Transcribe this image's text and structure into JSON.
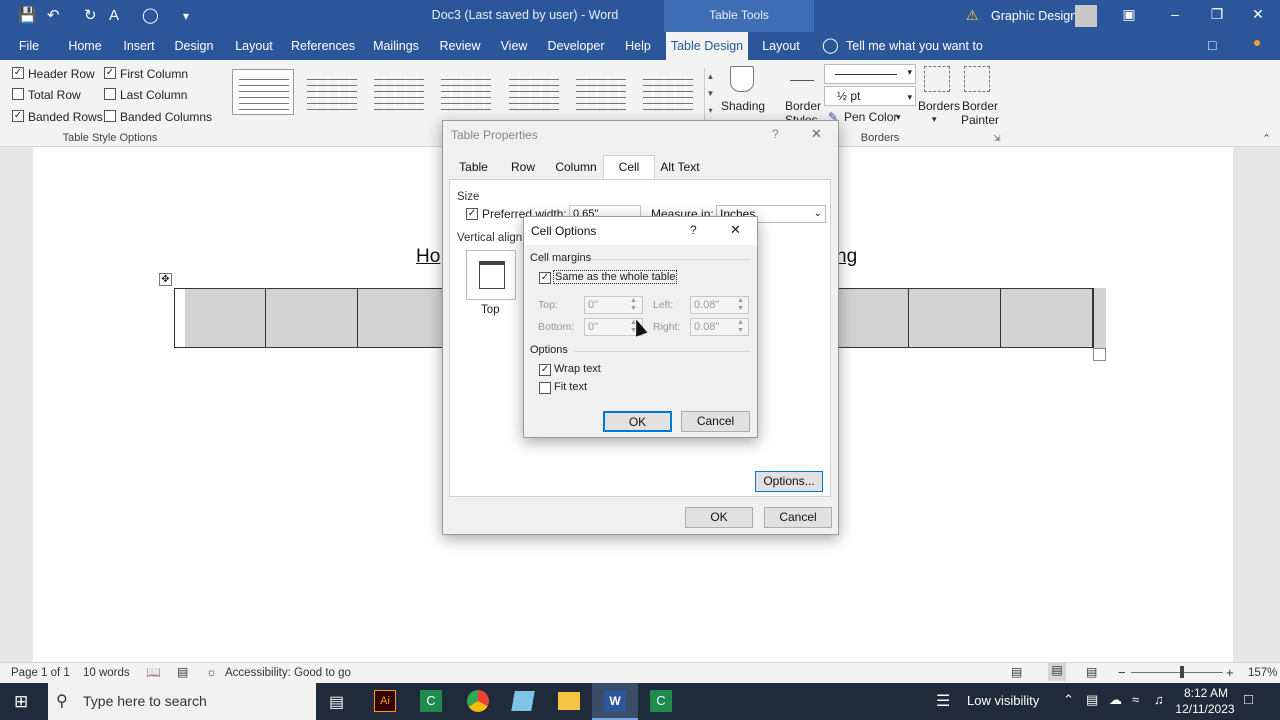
{
  "titlebar": {
    "doc_title": "Doc3 (Last saved by user)  -  Word",
    "table_tools": "Table Tools",
    "account": "Graphic Design"
  },
  "ribbon_tabs": [
    "File",
    "Home",
    "Insert",
    "Design",
    "Layout",
    "References",
    "Mailings",
    "Review",
    "View",
    "Developer",
    "Help",
    "Table Design",
    "Layout"
  ],
  "active_tab": "Table Design",
  "tell_me": "Tell me what you want to do",
  "style_options": {
    "header_row": "Header Row",
    "first_column": "First Column",
    "total_row": "Total Row",
    "last_column": "Last Column",
    "banded_rows": "Banded Rows",
    "banded_columns": "Banded Columns",
    "group_label": "Table Style Options"
  },
  "shading": "Shading",
  "borders": {
    "border_styles": "Border Styles",
    "weight": "½ pt",
    "pen_color": "Pen Color",
    "borders_btn": "Borders",
    "border_painter": "Border Painter",
    "group_label": "Borders"
  },
  "document": {
    "heading_left": "Ho",
    "heading_right": "ng"
  },
  "table_properties": {
    "title": "Table Properties",
    "help": "?",
    "close": "✕",
    "tabs": [
      "Table",
      "Row",
      "Column",
      "Cell",
      "Alt Text"
    ],
    "active_tab": "Cell",
    "size_label": "Size",
    "preferred_width_label": "Preferred width:",
    "preferred_width_value": "0.65\"",
    "measure_in_label": "Measure in:",
    "measure_in_value": "Inches",
    "vertical_alignment_label": "Vertical alignm",
    "top_label": "Top",
    "options_btn": "Options...",
    "ok": "OK",
    "cancel": "Cancel"
  },
  "cell_options": {
    "title": "Cell Options",
    "help": "?",
    "close": "✕",
    "cell_margins_label": "Cell margins",
    "same_as_table": "Same as the whole table",
    "top_label": "Top:",
    "top_value": "0\"",
    "bottom_label": "Bottom:",
    "bottom_value": "0\"",
    "left_label": "Left:",
    "left_value": "0.08\"",
    "right_label": "Right:",
    "right_value": "0.08\"",
    "options_label": "Options",
    "wrap_text": "Wrap text",
    "fit_text": "Fit text",
    "ok": "OK",
    "cancel": "Cancel"
  },
  "statusbar": {
    "page": "Page 1 of 1",
    "words": "10 words",
    "accessibility": "Accessibility: Good to go",
    "zoom": "157%"
  },
  "taskbar": {
    "search_placeholder": "Type here to search",
    "weather": "Low visibility",
    "time": "8:12 AM",
    "date": "12/11/2023"
  },
  "colors": {
    "accent": "#2b579a",
    "dialog_focus": "#0078d7"
  }
}
